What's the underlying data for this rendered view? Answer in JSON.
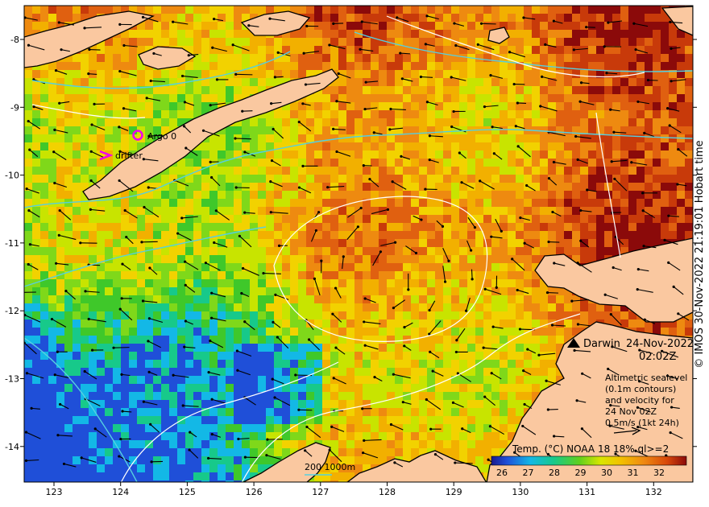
{
  "map": {
    "place": "Darwin",
    "date": "24-Nov-2022",
    "time": "02:02Z",
    "legend_sealevel": [
      "Altimetric sealevel",
      "(0.1m contours)",
      "and velocity for",
      "24 Nov 02Z",
      "0.5m/s (1kt 24h)"
    ],
    "colorbar_title": "Temp. (°C) NOAA 18 18% ql>=2",
    "colorbar_ticks": [
      "26",
      "27",
      "28",
      "29",
      "30",
      "31",
      "32"
    ],
    "depth_legend": "200  1000m",
    "argo_label": "Argo 0",
    "drifter_label": "drifter",
    "credit": "© IMOS 30-Nov-2022 21:19:01 Hobart time",
    "lon_ticks": [
      "123",
      "124",
      "125",
      "126",
      "127",
      "128",
      "129",
      "130",
      "131",
      "132"
    ],
    "lat_ticks": [
      "-8",
      "-9",
      "-10",
      "-11",
      "-12",
      "-13",
      "-14"
    ],
    "colors": {
      "land": "#fac8a0",
      "argo": "#ee00ee",
      "drifter": "#ee00ee",
      "depth_contour": "#55d0e0",
      "sealevel_contour": "#ffffff"
    }
  }
}
